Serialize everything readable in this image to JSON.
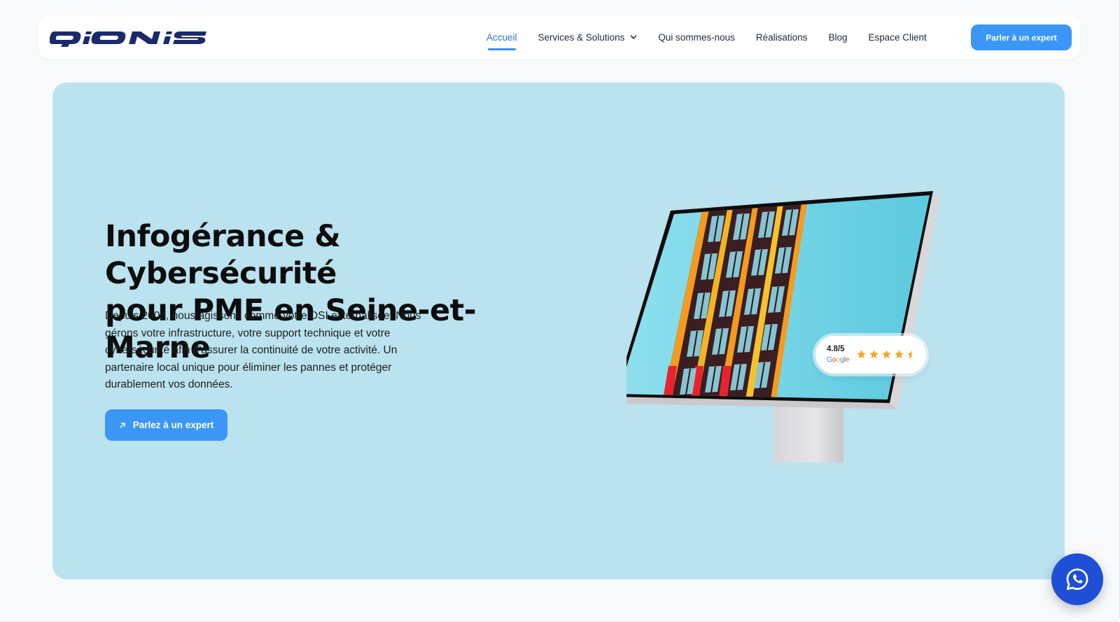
{
  "brand": {
    "logo_text": "QIONIS",
    "primary_color": "#3b97f6",
    "logo_color": "#1a2a6b"
  },
  "nav": {
    "items": [
      {
        "label": "Accueil",
        "active": true
      },
      {
        "label": "Services & Solutions",
        "dropdown": true
      },
      {
        "label": "Qui sommes-nous"
      },
      {
        "label": "Réalisations"
      },
      {
        "label": "Blog"
      },
      {
        "label": "Espace Client"
      }
    ],
    "cta_label": "Parler à un expert"
  },
  "hero": {
    "title_line1": "Infogérance & Cybersécurité",
    "title_line2": "pour PME en Seine-et-Marne",
    "description": "Depuis 2008, nous agissons comme votre DSI externalisée. Nous gérons votre infrastructure, votre support technique et votre cybersécurité afin d'assurer la continuité de votre activité. Un partenaire local unique pour éliminer les pannes et protéger durablement vos données.",
    "cta_label": "Parlez à un expert",
    "background_color": "#bae2ef"
  },
  "rating": {
    "value": "4.8/5",
    "source": "Google",
    "stars": 4.5,
    "star_color": "#f5a623"
  },
  "icons": {
    "chevron": "chevron-down-icon",
    "arrow": "arrow-up-right-icon",
    "star": "star-icon",
    "whatsapp": "whatsapp-icon"
  }
}
